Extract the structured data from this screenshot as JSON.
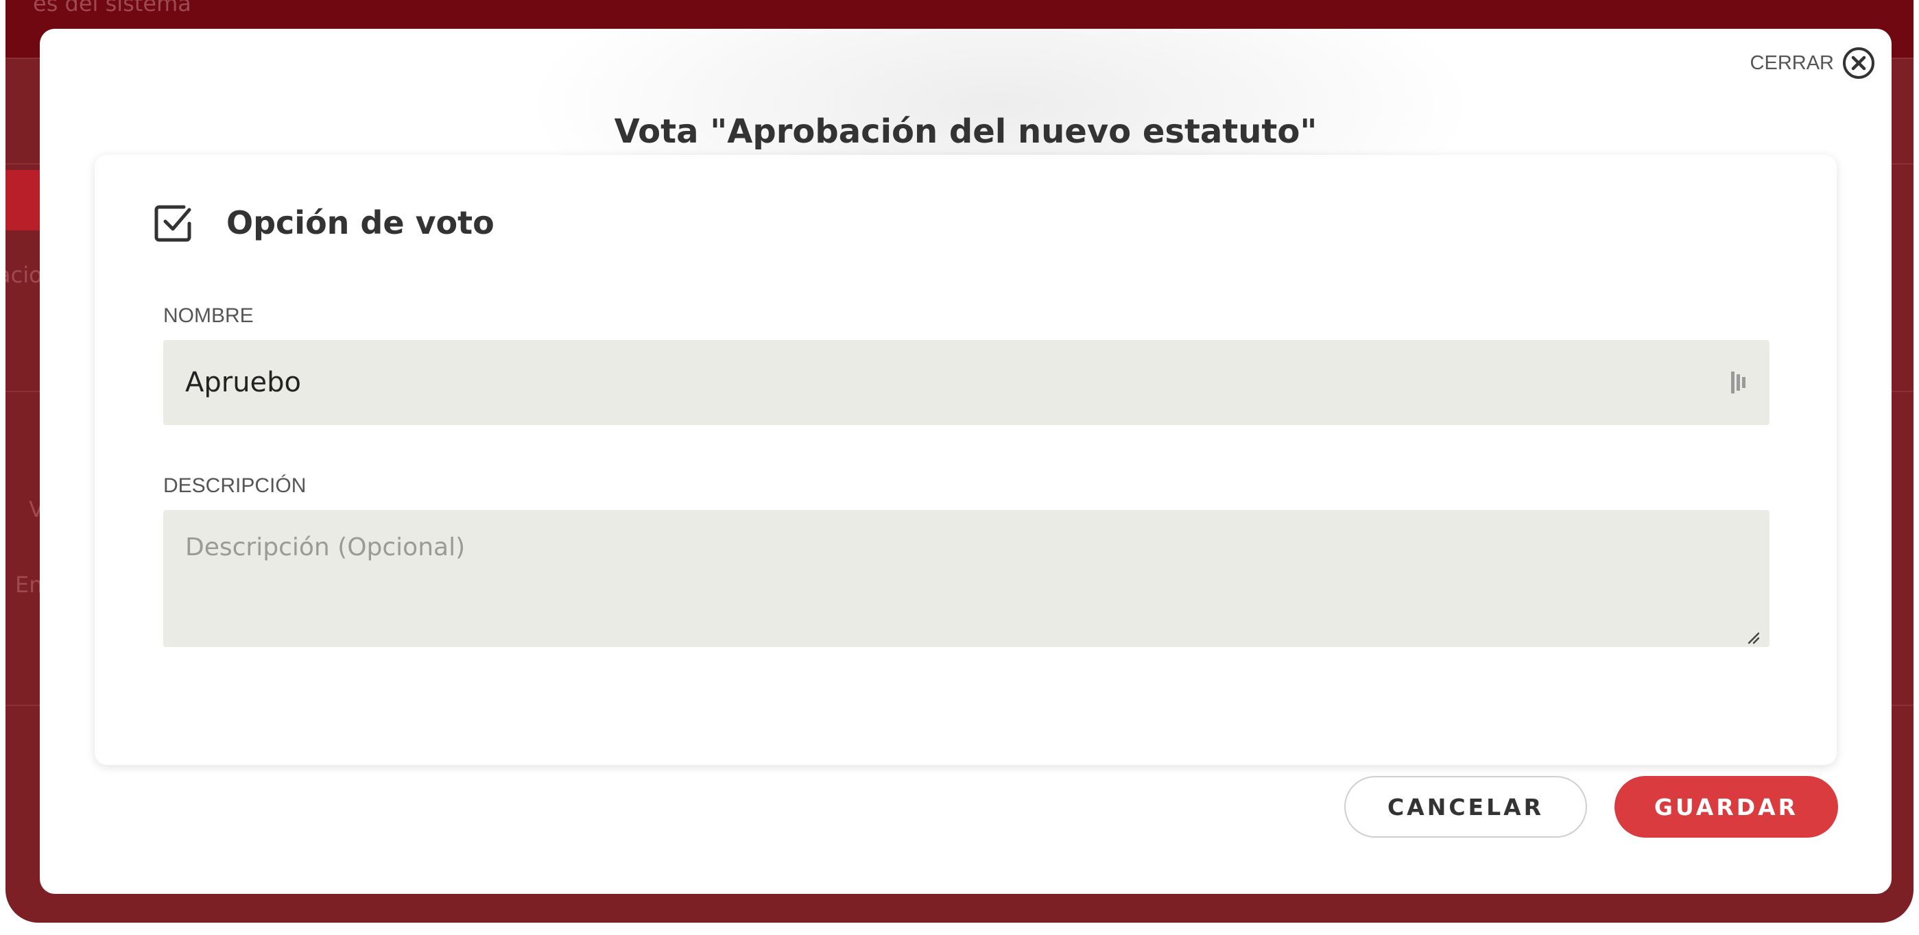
{
  "background": {
    "texts": [
      "es del sistema",
      "acio",
      "V",
      "En"
    ]
  },
  "modal": {
    "close_label": "CERRAR",
    "title": "Vota \"Aprobación del nuevo estatuto\""
  },
  "card": {
    "icon": "checkbox-checked-icon",
    "title": "Opción de voto",
    "name_label": "NOMBRE",
    "name_value": "Apruebo",
    "description_label": "DESCRIPCIÓN",
    "description_placeholder": "Descripción (Opcional)",
    "description_value": ""
  },
  "actions": {
    "cancel_label": "CANCELAR",
    "save_label": "GUARDAR"
  },
  "colors": {
    "backdrop": "#7c2026",
    "accent": "#d93b3e",
    "input_bg": "#ebebe6"
  }
}
